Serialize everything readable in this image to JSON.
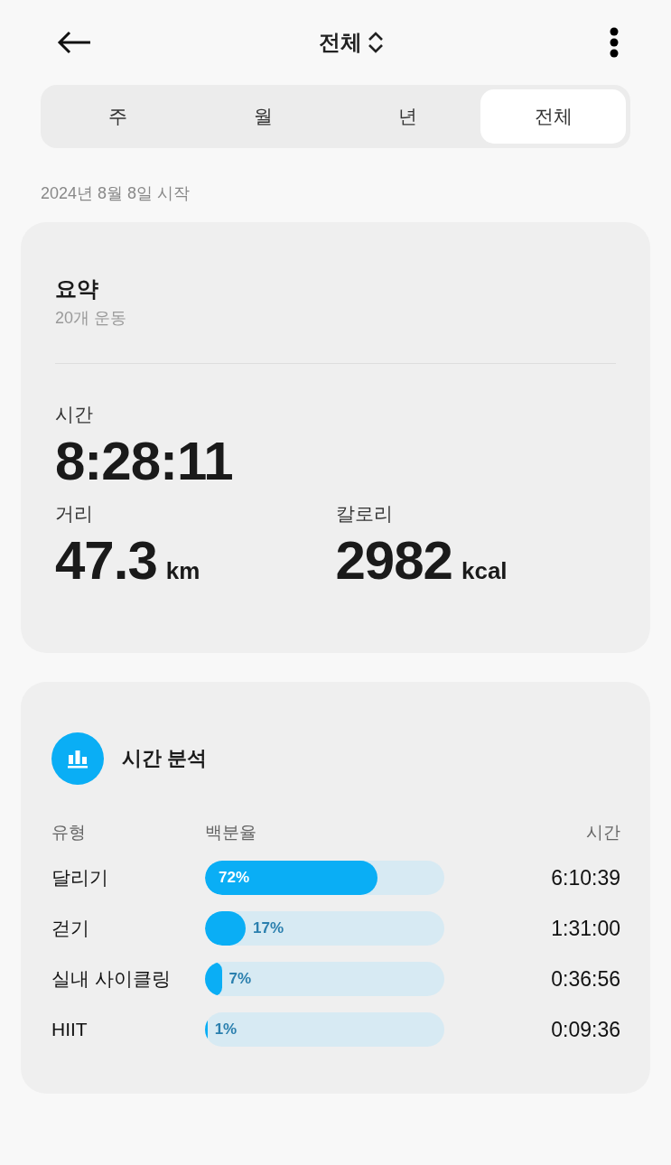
{
  "header": {
    "title": "전체"
  },
  "tabs": [
    {
      "label": "주",
      "selected": false
    },
    {
      "label": "월",
      "selected": false
    },
    {
      "label": "년",
      "selected": false
    },
    {
      "label": "전체",
      "selected": true
    }
  ],
  "start_date": "2024년 8월 8일 시작",
  "summary": {
    "title": "요약",
    "subtitle": "20개 운동",
    "time_label": "시간",
    "time": "8:28:11",
    "distance_label": "거리",
    "distance": "47.3",
    "distance_unit": "km",
    "calories_label": "칼로리",
    "calories": "2982",
    "calories_unit": "kcal"
  },
  "breakdown": {
    "title": "시간 분석",
    "columns": [
      "유형",
      "백분율",
      "시간"
    ],
    "rows": [
      {
        "type": "달리기",
        "percent": "72%",
        "level": 0.72,
        "time": "6:10:39"
      },
      {
        "type": "걷기",
        "percent": "17%",
        "level": 0.17,
        "time": "1:31:00"
      },
      {
        "type": "실내 사이클링",
        "percent": "7%",
        "level": 0.07,
        "time": "0:36:56"
      },
      {
        "type": "HIIT",
        "percent": "1%",
        "level": 0.01,
        "time": "0:09:36"
      }
    ]
  }
}
